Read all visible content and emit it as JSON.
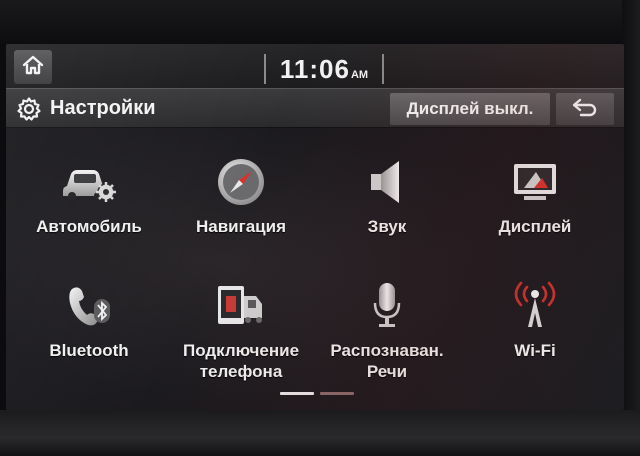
{
  "status_bar": {
    "time": "11:06",
    "ampm": "AM"
  },
  "header": {
    "title": "Настройки",
    "display_off_label": "Дисплей выкл."
  },
  "menu": {
    "items": [
      {
        "label": "Автомобиль",
        "icon": "car-settings-icon"
      },
      {
        "label": "Навигация",
        "icon": "compass-icon"
      },
      {
        "label": "Звук",
        "icon": "speaker-icon"
      },
      {
        "label": "Дисплей",
        "icon": "display-icon"
      },
      {
        "label": "Bluetooth",
        "icon": "bluetooth-phone-icon"
      },
      {
        "label_line1": "Подключение",
        "label_line2": "телефона",
        "icon": "phone-connection-icon"
      },
      {
        "label_line1": "Распознаван.",
        "label_line2": "Речи",
        "icon": "microphone-icon"
      },
      {
        "label": "Wi-Fi",
        "icon": "wifi-icon"
      }
    ]
  },
  "pagination": {
    "current_page": 1,
    "total_pages": 2
  }
}
